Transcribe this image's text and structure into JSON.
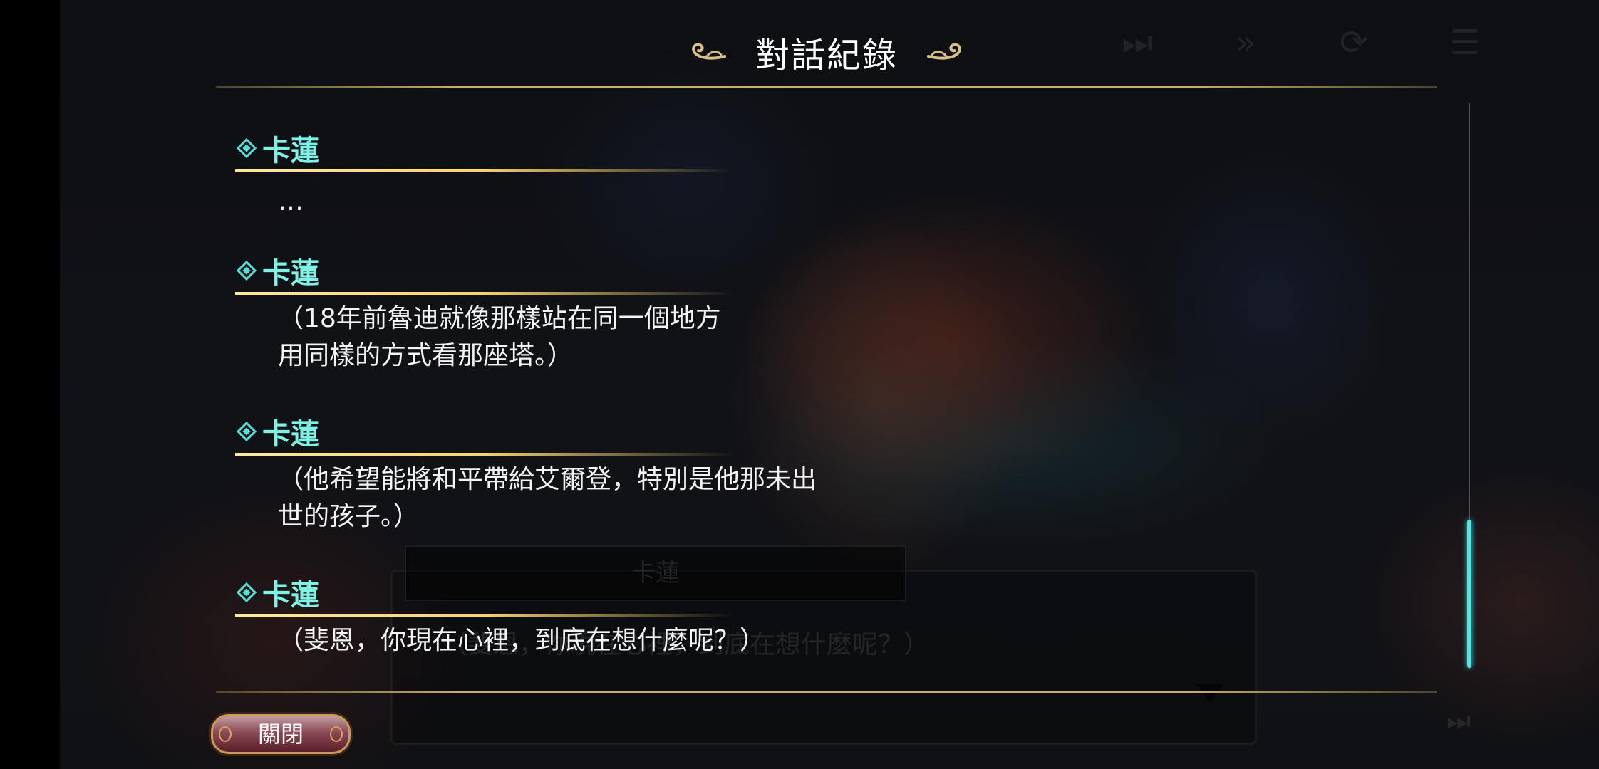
{
  "log": {
    "title": "對話紀錄",
    "close_label": "關閉",
    "entries": [
      {
        "speaker": "卡蓮",
        "lines": [
          "…"
        ]
      },
      {
        "speaker": "卡蓮",
        "lines": [
          "（18年前魯迪就像那樣站在同一個地方",
          "用同樣的方式看那座塔。）"
        ]
      },
      {
        "speaker": "卡蓮",
        "lines": [
          "（他希望能將和平帶給艾爾登，特別是他那未出",
          "世的孩子。）"
        ]
      },
      {
        "speaker": "卡蓮",
        "lines": [
          "（斐恩，你現在心裡，到底在想什麼呢？）"
        ]
      }
    ]
  },
  "underlay": {
    "speaker": "卡蓮",
    "text": "（斐恩，你現在心裡，到底在想什麼呢？）"
  },
  "colors": {
    "speaker": "#7ff2e6",
    "underline": "#f5d36e",
    "divider": "#c9ad6a",
    "scroll_thumb": "#4fe8e4",
    "close_button": "#8a4a55"
  }
}
